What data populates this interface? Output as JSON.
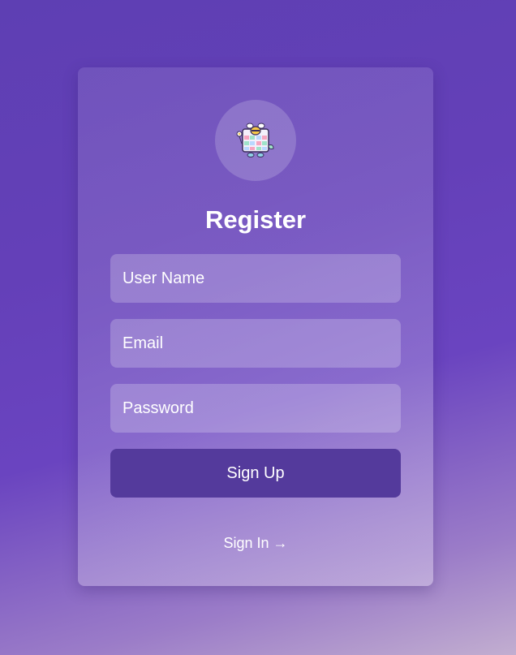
{
  "register_form": {
    "logo_icon": "bee-calendar-logo",
    "title": "Register",
    "username_placeholder": "User Name",
    "email_placeholder": "Email",
    "password_placeholder": "Password",
    "signup_label": "Sign Up",
    "signin_link": "Sign In →"
  },
  "colors": {
    "background_top": "#5e3fb3",
    "background_bottom": "#c2aed0",
    "button": "#543a9c",
    "text": "#ffffff"
  }
}
